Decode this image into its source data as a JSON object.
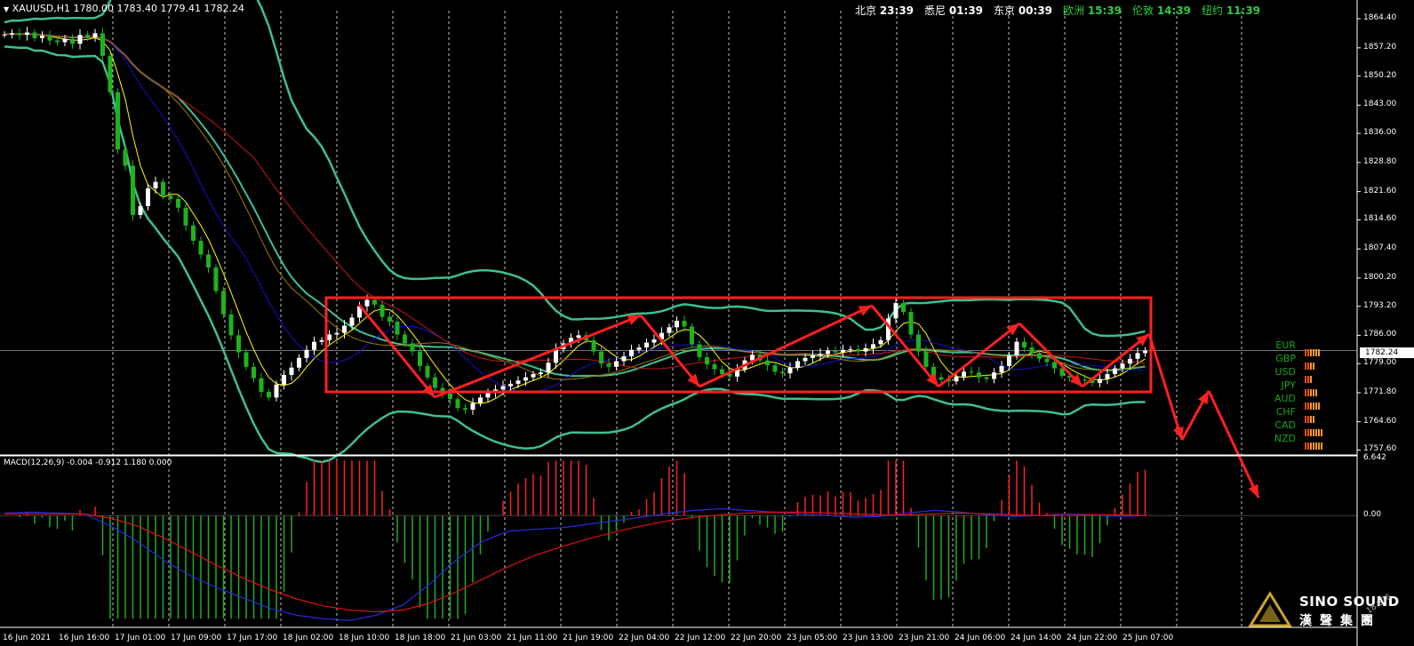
{
  "header": {
    "symbol_info": "XAUUSD,H1  1780.00 1783.40 1779.41 1782.24",
    "macd_info": "MACD(12,26,9) -0.004 -0.912 1.180 0.000",
    "clocks": [
      {
        "city": "北京",
        "time": "23:39",
        "color": "#ffffff"
      },
      {
        "city": "悉尼",
        "time": "01:39",
        "color": "#ffffff"
      },
      {
        "city": "东京",
        "time": "00:39",
        "color": "#ffffff"
      },
      {
        "city": "欧洲",
        "time": "15:39",
        "color": "#2ecc40"
      },
      {
        "city": "伦敦",
        "time": "14:39",
        "color": "#2ecc40"
      },
      {
        "city": "纽约",
        "time": "11:39",
        "color": "#2ecc40"
      }
    ]
  },
  "currency_strength": [
    {
      "code": "EUR",
      "strength": 6
    },
    {
      "code": "GBP",
      "strength": 4
    },
    {
      "code": "USD",
      "strength": 3
    },
    {
      "code": "JPY",
      "strength": 5
    },
    {
      "code": "AUD",
      "strength": 6
    },
    {
      "code": "CHF",
      "strength": 4
    },
    {
      "code": "CAD",
      "strength": 7
    },
    {
      "code": "NZD",
      "strength": 7
    }
  ],
  "branding": {
    "logo_text": "SINO SOUND",
    "logo_cn": "漢聲集團",
    "corner_mark": "18.876"
  },
  "colors": {
    "bull_candle": "#ffffff",
    "bear_candle": "#1db31d",
    "bollinger": "#3fbf8f",
    "ma_fast": "#ffff00",
    "ma_mid": "#1111cc",
    "ma_slow": "#cc1111",
    "ma_gold": "#9c7a00",
    "annotation": "#ff2020",
    "macd_pos": "#ff2020",
    "macd_neg": "#22aa22",
    "macd_line": "#2a2ae0",
    "signal_line": "#e01010",
    "grid": "#ffffff"
  },
  "chart_data": [
    {
      "type": "candlestick",
      "title": "XAUUSD,H1",
      "ylim": [
        1756.6,
        1866.4
      ],
      "y_ticks": [
        "1864.40",
        "1857.20",
        "1850.20",
        "1843.00",
        "1836.00",
        "1828.80",
        "1821.60",
        "1814.60",
        "1807.40",
        "1800.20",
        "1793.20",
        "1786.00",
        "1779.00",
        "1771.80",
        "1764.60",
        "1757.60"
      ],
      "current_price": "1782.24",
      "x_labels": [
        "16 Jun 2021",
        "16 Jun 16:00",
        "17 Jun 01:00",
        "17 Jun 09:00",
        "17 Jun 17:00",
        "18 Jun 02:00",
        "18 Jun 10:00",
        "18 Jun 18:00",
        "21 Jun 03:00",
        "21 Jun 11:00",
        "21 Jun 19:00",
        "22 Jun 04:00",
        "22 Jun 12:00",
        "22 Jun 20:00",
        "23 Jun 05:00",
        "23 Jun 13:00",
        "23 Jun 21:00",
        "24 Jun 06:00",
        "24 Jun 14:00",
        "24 Jun 22:00",
        "25 Jun 07:00"
      ],
      "close_path": [
        1860.5,
        1860.8,
        1860.4,
        1861.0,
        1859.6,
        1860.2,
        1859.0,
        1858.6,
        1859.4,
        1858.2,
        1860.4,
        1859.8,
        1860.8,
        1855.2,
        1846.2,
        1832.0,
        1828.0,
        1815.8,
        1818.0,
        1822.4,
        1824.0,
        1820.6,
        1819.8,
        1817.6,
        1813.2,
        1809.4,
        1806.0,
        1802.8,
        1797.0,
        1791.2,
        1786.0,
        1781.8,
        1778.2,
        1775.4,
        1772.0,
        1770.6,
        1773.8,
        1776.2,
        1778.0,
        1780.4,
        1782.4,
        1784.4,
        1784.8,
        1786.2,
        1786.6,
        1788.4,
        1790.4,
        1793.2,
        1794.8,
        1793.6,
        1790.6,
        1789.4,
        1786.2,
        1784.0,
        1782.0,
        1778.4,
        1775.6,
        1773.0,
        1771.6,
        1770.2,
        1768.0,
        1767.6,
        1769.2,
        1770.6,
        1771.8,
        1772.6,
        1773.4,
        1774.0,
        1774.8,
        1775.6,
        1776.4,
        1776.8,
        1779.2,
        1782.6,
        1784.0,
        1785.4,
        1786.0,
        1784.8,
        1782.0,
        1779.0,
        1778.2,
        1779.6,
        1780.8,
        1782.4,
        1783.0,
        1784.2,
        1785.0,
        1786.6,
        1788.0,
        1789.6,
        1788.2,
        1783.8,
        1780.6,
        1778.8,
        1777.6,
        1776.4,
        1775.8,
        1777.6,
        1779.8,
        1781.2,
        1779.8,
        1778.6,
        1777.0,
        1776.6,
        1778.0,
        1779.6,
        1780.4,
        1781.0,
        1781.4,
        1782.2,
        1781.8,
        1782.4,
        1782.6,
        1782.0,
        1782.8,
        1783.8,
        1784.8,
        1790.2,
        1794.0,
        1791.8,
        1786.2,
        1782.0,
        1778.2,
        1775.6,
        1775.0,
        1774.6,
        1775.8,
        1777.0,
        1776.8,
        1775.6,
        1775.2,
        1776.8,
        1778.4,
        1781.0,
        1784.4,
        1783.0,
        1781.6,
        1780.2,
        1779.4,
        1777.8,
        1776.0,
        1775.6,
        1775.0,
        1774.8,
        1774.2,
        1775.2,
        1776.4,
        1777.8,
        1779.0,
        1780.2,
        1781.6,
        1782.2
      ],
      "series": [
        {
          "name": "MACD",
          "values": [
            0.3,
            0.4,
            0.3,
            0.2,
            -1.2,
            -3.0,
            -5.2,
            -7.0,
            -8.4,
            -9.6,
            -10.8,
            -11.6,
            -12.0,
            -12.2,
            -11.6,
            -10.4,
            -8.0,
            -5.2,
            -3.0,
            -1.8,
            -1.6,
            -1.4,
            -1.0,
            -0.6,
            -0.2,
            0.3,
            0.6,
            0.8,
            0.6,
            0.4,
            0.2,
            0.0,
            -0.2,
            -0.1,
            0.3,
            0.6,
            0.4,
            0.1,
            -0.1,
            0.0,
            0.2,
            0.1,
            -0.1,
            0.0
          ]
        },
        {
          "name": "Signal",
          "values": [
            0.2,
            0.2,
            0.2,
            0.2,
            -0.3,
            -1.2,
            -2.6,
            -4.2,
            -5.8,
            -7.3,
            -8.6,
            -9.7,
            -10.5,
            -11.0,
            -11.2,
            -11.0,
            -10.2,
            -8.9,
            -7.4,
            -5.9,
            -4.6,
            -3.6,
            -2.7,
            -1.9,
            -1.2,
            -0.6,
            -0.2,
            0.1,
            0.3,
            0.4,
            0.4,
            0.3,
            0.2,
            0.1,
            0.1,
            0.2,
            0.3,
            0.2,
            0.1,
            0.0,
            0.0,
            0.1,
            0.1,
            0.0
          ]
        }
      ]
    },
    {
      "type": "bar",
      "title": "MACD(12,26,9)",
      "y_ticks": [
        "6.642",
        "0.00"
      ],
      "ylim": [
        -12.8,
        6.642
      ]
    }
  ]
}
